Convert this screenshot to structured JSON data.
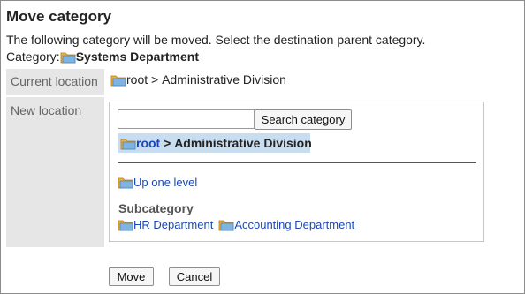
{
  "dialog": {
    "title": "Move category",
    "description": "The following category will be moved. Select the destination parent category.",
    "category_label": "Category:",
    "category_name": "Systems Department"
  },
  "current_location": {
    "label": "Current location",
    "root": "root",
    "separator": " > ",
    "path": "Administrative Division"
  },
  "new_location": {
    "label": "New location",
    "search": {
      "value": "",
      "placeholder": "",
      "button_label": "Search category"
    },
    "selected_path": {
      "root": "root",
      "separator": " > ",
      "path": "Administrative Division"
    },
    "up_one_level": "Up one level",
    "subcategory_heading": "Subcategory",
    "subcategories": [
      "HR Department",
      "Accounting Department"
    ]
  },
  "actions": {
    "move_label": "Move",
    "cancel_label": "Cancel"
  },
  "icons": {
    "folder": "folder-icon"
  },
  "colors": {
    "label_bg": "#e6e6e6",
    "link": "#1a48b8",
    "selection_bg": "#c9ddf1",
    "folder": "#f2b03c"
  }
}
